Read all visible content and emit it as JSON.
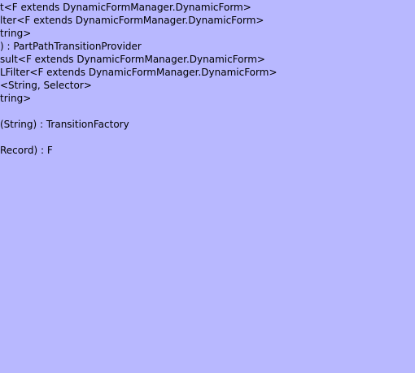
{
  "members": [
    "t<F extends DynamicFormManager.DynamicForm>",
    "lter<F extends DynamicFormManager.DynamicForm>",
    "tring>",
    ") : PartPathTransitionProvider",
    "sult<F extends DynamicFormManager.DynamicForm>",
    "LFilter<F extends DynamicFormManager.DynamicForm>",
    "<String, Selector>",
    "tring>",
    "",
    "(String) : TransitionFactory",
    "",
    "Record) : F"
  ]
}
